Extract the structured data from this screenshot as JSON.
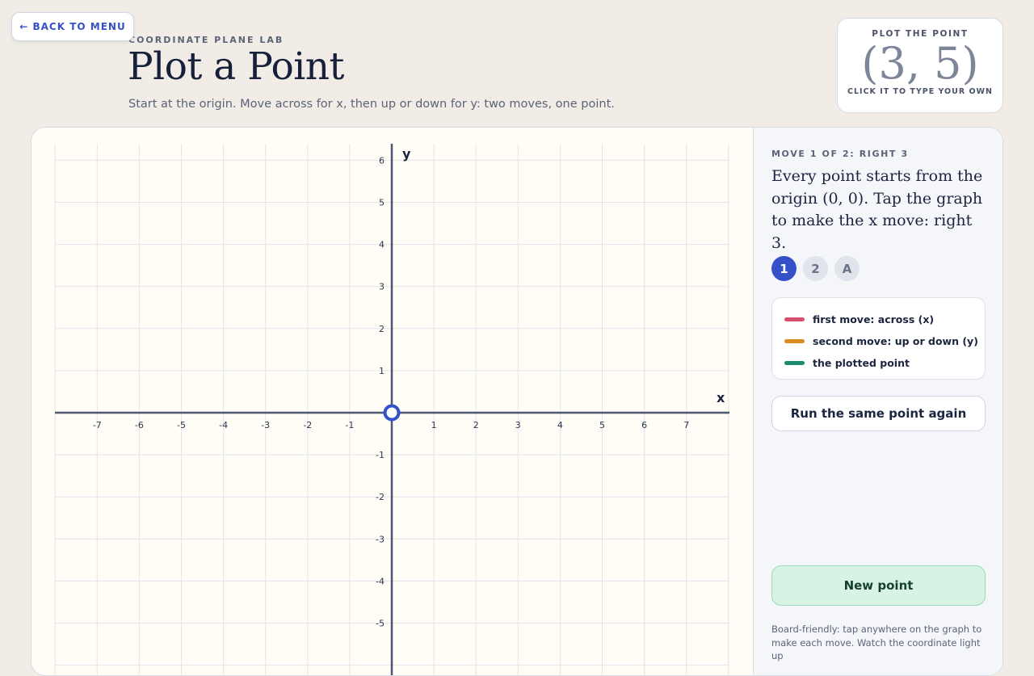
{
  "nav": {
    "back_label": "← BACK TO MENU"
  },
  "header": {
    "eyebrow": "COORDINATE PLANE LAB",
    "title": "Plot a Point",
    "subtitle": "Start at the origin. Move across for x, then up or down for y: two moves, one point."
  },
  "target": {
    "label": "PLOT THE POINT",
    "coord": "(3, 5)",
    "hint": "CLICK IT TO TYPE YOUR OWN"
  },
  "graph": {
    "x_axis_label": "x",
    "y_axis_label": "y",
    "x_min": -7,
    "x_max": 7,
    "y_min": -5,
    "y_max": 6,
    "x_ticks": [
      "-7",
      "-6",
      "-5",
      "-4",
      "-3",
      "-2",
      "-1",
      "1",
      "2",
      "3",
      "4",
      "5",
      "6",
      "7"
    ],
    "y_ticks": [
      "6",
      "5",
      "4",
      "3",
      "2",
      "1",
      "-1",
      "-2",
      "-3",
      "-4",
      "-5"
    ],
    "cursor_point": [
      0,
      0
    ],
    "colors": {
      "axis": "#4b5673",
      "grid": "#e2e5ec",
      "cursor": "#3551c9"
    }
  },
  "side": {
    "move_label": "MOVE 1 OF 2: RIGHT 3",
    "instruction": "Every point starts from the origin (0, 0). Tap the graph to make the x move: right 3.",
    "steps": [
      {
        "label": "1",
        "state": "active"
      },
      {
        "label": "2",
        "state": "pending"
      },
      {
        "label": "A",
        "state": "pending"
      }
    ],
    "legend": [
      {
        "label": "first move: across (x)",
        "color": "#d9506f"
      },
      {
        "label": "second move: up or down (y)",
        "color": "#d98b22"
      },
      {
        "label": "the plotted point",
        "color": "#1a8a6a"
      }
    ],
    "again_label": "Run the same point again",
    "new_label": "New point",
    "footnote": "Board-friendly: tap anywhere on the graph to make each move. Watch the coordinate light up"
  }
}
